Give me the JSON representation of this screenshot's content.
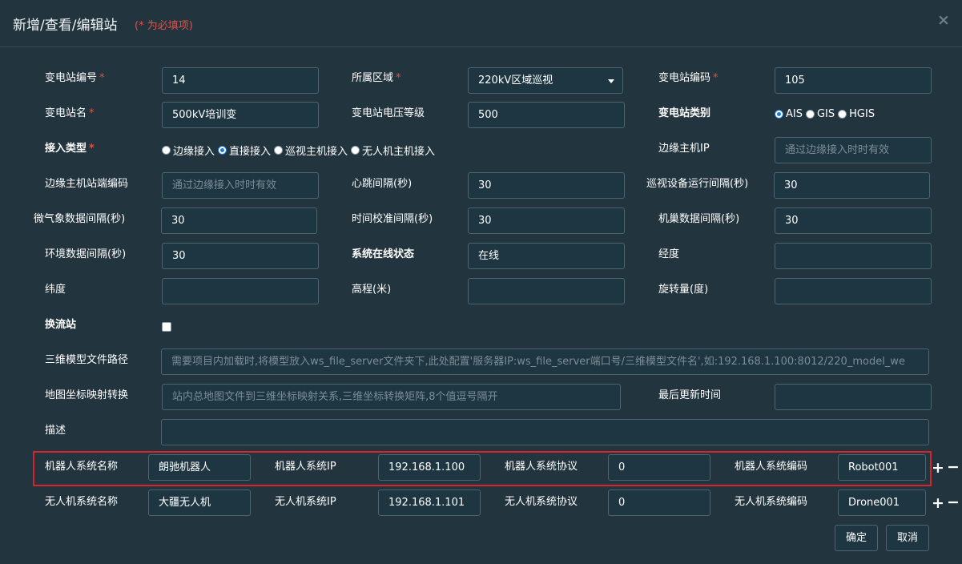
{
  "dialog": {
    "title": "新增/查看/编辑站",
    "required_note": "(* 为必填项)",
    "close_icon": "×"
  },
  "form": {
    "station_no": {
      "label": "变电站编号",
      "value": "14"
    },
    "region": {
      "label": "所属区域",
      "value": "220kV区域巡视"
    },
    "station_code": {
      "label": "变电站编码",
      "value": "105"
    },
    "station_name": {
      "label": "变电站名",
      "value": "500kV培训变"
    },
    "voltage_level": {
      "label": "变电站电压等级",
      "value": "500"
    },
    "station_type": {
      "label": "变电站类别",
      "options": [
        "AIS",
        "GIS",
        "HGIS"
      ],
      "selected": "AIS"
    },
    "access_type": {
      "label": "接入类型",
      "options": [
        "边缘接入",
        "直接接入",
        "巡视主机接入",
        "无人机主机接入"
      ],
      "selected": "直接接入"
    },
    "edge_host_ip": {
      "label": "边缘主机IP",
      "placeholder": "通过边缘接入时时有效"
    },
    "edge_host_station_code": {
      "label": "边缘主机站端编码",
      "placeholder": "通过边缘接入时时有效"
    },
    "heartbeat_interval": {
      "label": "心跳间隔(秒)",
      "value": "30"
    },
    "device_run_interval": {
      "label": "巡视设备运行间隔(秒)",
      "value": "30"
    },
    "weather_interval": {
      "label": "微气象数据间隔(秒)",
      "value": "30"
    },
    "time_sync_interval": {
      "label": "时间校准间隔(秒)",
      "value": "30"
    },
    "nest_interval": {
      "label": "机巢数据间隔(秒)",
      "value": "30"
    },
    "env_interval": {
      "label": "环境数据间隔(秒)",
      "value": "30"
    },
    "online_status": {
      "label": "系统在线状态",
      "value": "在线"
    },
    "longitude": {
      "label": "经度",
      "value": ""
    },
    "latitude": {
      "label": "纬度",
      "value": ""
    },
    "elevation": {
      "label": "高程(米)",
      "value": ""
    },
    "rotation": {
      "label": "旋转量(度)",
      "value": ""
    },
    "converter_station": {
      "label": "换流站",
      "checked": false
    },
    "model_path": {
      "label": "三维模型文件路径",
      "placeholder": "需要项目内加载时,将模型放入ws_file_server文件夹下,此处配置'服务器IP:ws_file_server端口号/三维模型文件名',如:192.168.1.100:8012/220_model_we"
    },
    "map_transform": {
      "label": "地图坐标映射转换",
      "placeholder": "站内总地图文件到三维坐标映射关系,三维坐标转换矩阵,8个值逗号隔开"
    },
    "last_update": {
      "label": "最后更新时间",
      "value": ""
    },
    "description": {
      "label": "描述",
      "value": ""
    }
  },
  "robot": {
    "name_label": "机器人系统名称",
    "name": "朗驰机器人",
    "ip_label": "机器人系统IP",
    "ip": "192.168.1.100",
    "protocol_label": "机器人系统协议",
    "protocol": "0",
    "code_label": "机器人系统编码",
    "code": "Robot001"
  },
  "drone": {
    "name_label": "无人机系统名称",
    "name": "大疆无人机",
    "ip_label": "无人机系统IP",
    "ip": "192.168.1.101",
    "protocol_label": "无人机系统协议",
    "protocol": "0",
    "code_label": "无人机系统编码",
    "code": "Drone001"
  },
  "row_controls": {
    "add": "+",
    "remove": "−"
  },
  "buttons": {
    "confirm": "确定",
    "cancel": "取消"
  },
  "colors": {
    "background": "#22343d",
    "input_bg": "#1d3642",
    "required": "#e0504a",
    "highlight_border": "#d6262b",
    "radio_selected": "#1f7ad6"
  }
}
